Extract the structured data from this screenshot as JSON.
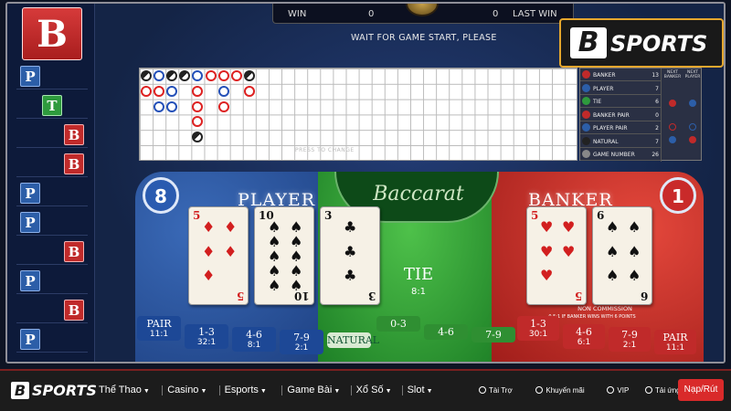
{
  "brand": {
    "logo_text": "SPORTS",
    "logo_mark": "B",
    "accent": "#d92a2a",
    "gold": "#e5a72e"
  },
  "roadmap": {
    "last_result": "B",
    "rows": [
      "P",
      "T",
      "B",
      "B",
      "P",
      "P",
      "B",
      "P",
      "B",
      "P"
    ]
  },
  "scoreboard": {
    "win_label": "WIN",
    "win_value": "0",
    "win_value2": "0",
    "last_win_label": "LAST WIN"
  },
  "status": "WAIT FOR GAME START, PLEASE",
  "bead_road": {
    "press_label": "PRESS TO CHANGE"
  },
  "stats": [
    {
      "label": "BANKER",
      "count": "13",
      "color": "#c02a2a"
    },
    {
      "label": "PLAYER",
      "count": "7",
      "color": "#2c5ea8"
    },
    {
      "label": "TIE",
      "count": "6",
      "color": "#2e9a3d"
    },
    {
      "label": "BANKER PAIR",
      "count": "0",
      "color": "#c02a2a"
    },
    {
      "label": "PLAYER PAIR",
      "count": "2",
      "color": "#2c5ea8"
    },
    {
      "label": "NATURAL",
      "count": "7",
      "color": "#222222"
    },
    {
      "label": "GAME NUMBER",
      "count": "26",
      "color": "#888888"
    }
  ],
  "next": {
    "banker_label": "NEXT BANKER",
    "player_label": "NEXT PLAYER"
  },
  "table": {
    "brand_script": "Baccarat",
    "player_title": "PLAYER",
    "banker_title": "BANKER",
    "player_score": "8",
    "banker_score": "1",
    "tie_label": "TIE",
    "tie_odds": "8:1",
    "no_commission": "NON COMMISSION",
    "no_commission_sub": "0.5:1 IF BANKER WINS WITH 6 POINTS",
    "player_cards": [
      {
        "rank": "5",
        "suit": "♦",
        "color": "red"
      },
      {
        "rank": "10",
        "suit": "♠",
        "color": "blk"
      },
      {
        "rank": "3",
        "suit": "♣",
        "color": "blk"
      }
    ],
    "banker_cards": [
      {
        "rank": "5",
        "suit": "♥",
        "color": "red"
      },
      {
        "rank": "6",
        "suit": "♠",
        "color": "blk"
      }
    ],
    "bets_left": [
      {
        "label": "PAIR",
        "odds": "11:1"
      },
      {
        "label": "1-3",
        "odds": "32:1"
      },
      {
        "label": "4-6",
        "odds": "8:1"
      },
      {
        "label": "7-9",
        "odds": "2:1"
      },
      {
        "label": "NATURAL",
        "odds": ""
      }
    ],
    "bets_mid": [
      {
        "label": "0-3",
        "odds": ""
      },
      {
        "label": "4-6",
        "odds": ""
      },
      {
        "label": "7-9",
        "odds": ""
      }
    ],
    "bets_right": [
      {
        "label": "1-3",
        "odds": "30:1"
      },
      {
        "label": "4-6",
        "odds": "6:1"
      },
      {
        "label": "7-9",
        "odds": "2:1"
      },
      {
        "label": "PAIR",
        "odds": "11:1"
      }
    ]
  },
  "nav": {
    "items": [
      {
        "label": "Thể Thao"
      },
      {
        "label": "Casino"
      },
      {
        "label": "Esports"
      },
      {
        "label": "Game Bài"
      },
      {
        "label": "Xổ Số"
      },
      {
        "label": "Slot"
      }
    ],
    "utils": [
      {
        "label": "Tài Trợ",
        "icon": "sponsor-icon"
      },
      {
        "label": "Khuyến mãi",
        "icon": "promo-icon"
      },
      {
        "label": "VIP",
        "icon": "vip-icon"
      },
      {
        "label": "Tải ứng dụng",
        "icon": "app-download-icon"
      }
    ],
    "deposit_label": "Nạp/Rút"
  }
}
